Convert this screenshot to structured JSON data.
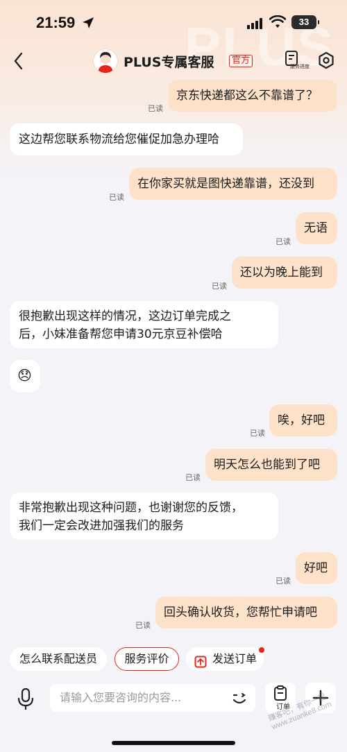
{
  "status": {
    "time": "21:59",
    "battery": "33"
  },
  "header": {
    "title": "PLUS专属客服",
    "badge": "官方",
    "service_caption": "服务进度",
    "watermark": "PLUS"
  },
  "messages": [
    {
      "from": "me",
      "text": "京东快递都这么不靠谱了？",
      "read": "已读"
    },
    {
      "from": "them",
      "text": "这边帮您联系物流给您催促加急办理哈"
    },
    {
      "from": "me",
      "text": "在你家买就是图快递靠谱，还没到",
      "read": "已读"
    },
    {
      "from": "me",
      "text": "无语",
      "read": "已读"
    },
    {
      "from": "me",
      "text": "还以为晚上能到",
      "read": "已读"
    },
    {
      "from": "them",
      "line1": "很抱歉出现这样的情况，这边订单完成之",
      "line2": "后，小妹准备帮您申请30元京豆补偿哈"
    },
    {
      "from": "them",
      "emoji": "😞"
    },
    {
      "from": "me",
      "text": "唉，好吧",
      "read": "已读"
    },
    {
      "from": "me",
      "text": "明天怎么也能到了吧",
      "read": "已读"
    },
    {
      "from": "them",
      "line1": "非常抱歉出现这种问题，也谢谢您的反馈，",
      "line2": "我们一定会改进加强我们的服务"
    },
    {
      "from": "me",
      "text": "好吧",
      "read": "已读"
    },
    {
      "from": "me",
      "text": "回头确认收货，您帮忙申请吧",
      "read": "已读"
    }
  ],
  "quick_actions": [
    "怎么联系配送员",
    "服务评价",
    "发送订单"
  ],
  "input": {
    "placeholder": "请输入您要咨询的内容...",
    "order_caption": "订单"
  },
  "watermark_text": "赚客吧，有你一起 www.zuanke8.com",
  "colors": {
    "accent": "#e1251b",
    "my_bubble": "#fde1c9",
    "their_bubble": "#ffffff"
  },
  "icons": [
    "location-arrow-icon",
    "signal-icon",
    "wifi-icon",
    "back-icon",
    "service-progress-icon",
    "settings-icon",
    "order-icon",
    "microphone-icon",
    "emoji-icon",
    "plus-icon"
  ]
}
